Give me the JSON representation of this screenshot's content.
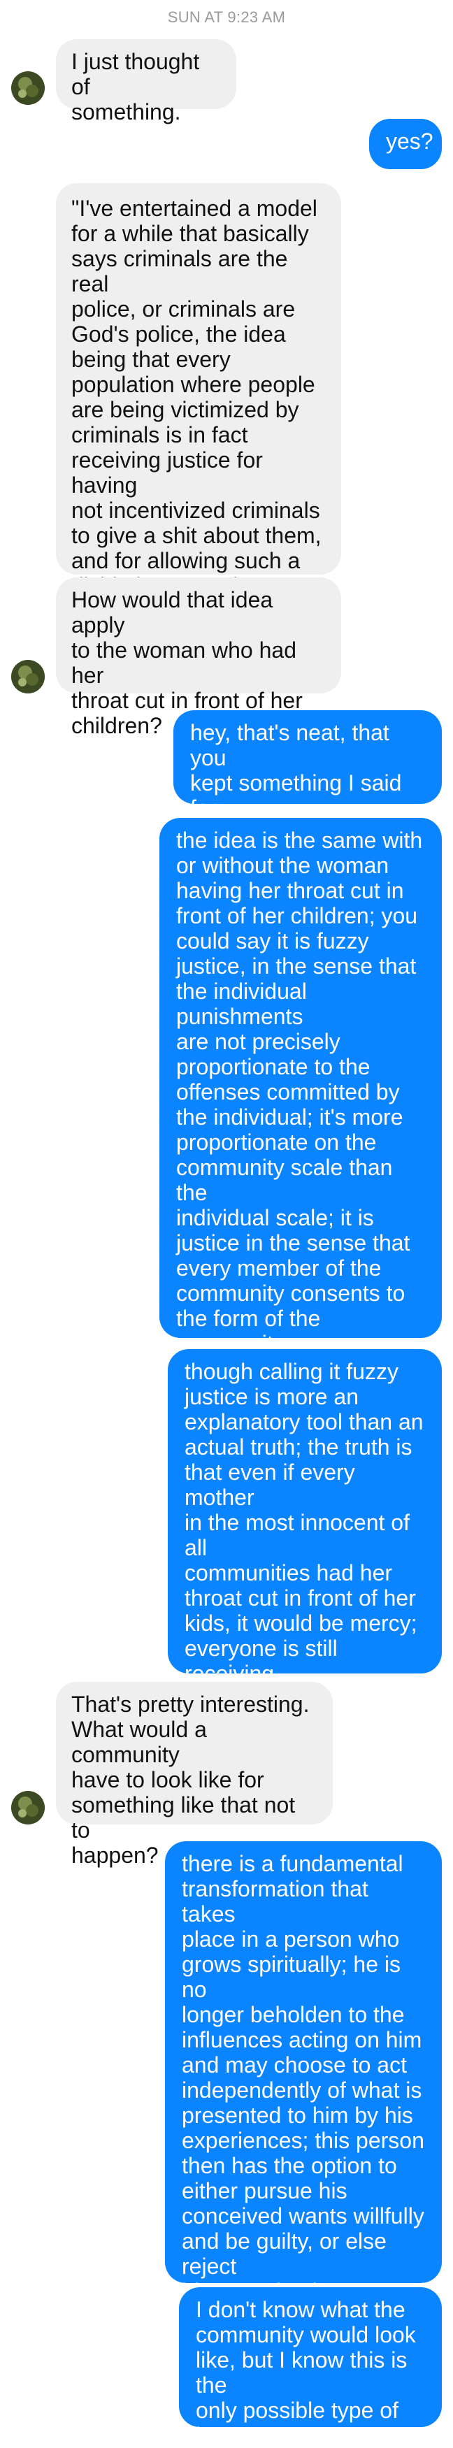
{
  "conversation": {
    "timestamp": "SUN AT 9:23 AM",
    "messages": [
      {
        "sender": "them",
        "text": "I just thought of\nsomething."
      },
      {
        "sender": "me",
        "text": "yes?"
      },
      {
        "sender": "them",
        "text": "\"I've entertained a model\nfor a while that basically\nsays criminals are the real\npolice, or criminals are\nGod's police, the idea\nbeing that every\npopulation where people\nare being victimized by\ncriminals is in fact\nreceiving justice for having\nnot incentivized criminals\nto give a shit about them,\nand for allowing such a\ndivide between those who\nhave and those who want\""
      },
      {
        "sender": "them",
        "text": "How would that idea apply\nto the woman who had her\nthroat cut in front of her\nchildren?"
      },
      {
        "sender": "me",
        "text": "hey, that's neat, that you\nkept something I said for\nfuture consideration"
      },
      {
        "sender": "me",
        "text": "the idea is the same with\nor without the woman\nhaving her throat cut in\nfront of her children; you\ncould say it is fuzzy\njustice, in the sense that\nthe individual punishments\nare not precisely\nproportionate to the\noffenses committed by\nthe individual; it's more\nproportionate on the\ncommunity scale than the\nindividual scale; it is\njustice in the sense that\nevery member of the\ncommunity consents to\nthe form of the community\nand plays a role in\ndictating its form"
      },
      {
        "sender": "me",
        "text": "though calling it fuzzy\njustice is more an\nexplanatory tool than an\nactual truth; the truth is\nthat even if every mother\nin the most innocent of all\ncommunities had her\nthroat cut in front of her\nkids, it would be mercy;\neveryone is still receiving\nmore grace than he has\nearned, for free"
      },
      {
        "sender": "them",
        "text": "That's pretty interesting.\nWhat would a community\nhave to look like for\nsomething like that not to\nhappen?"
      },
      {
        "sender": "me",
        "text": "there is a fundamental\ntransformation that takes\nplace in a person who\ngrows spiritually; he is no\nlonger beholden to the\ninfluences acting on him\nand may choose to act\nindependently of what is\npresented to him by his\nexperiences; this person\nthen has the option to\neither pursue his\nconceived wants willfully\nand be guilty, or else reject\nhis conceived wants and\nseek the good, and be\ninnocent"
      },
      {
        "sender": "me",
        "text": "I don't know what the\ncommunity would look\nlike, but I know this is the\nonly possible type of\ninnocent person"
      }
    ]
  },
  "colors": {
    "incoming_bubble": "#efefef",
    "outgoing_bubble": "#0a84ff",
    "timestamp_text": "#9a9a9a"
  },
  "icons": {
    "avatar": "contact-avatar-photo"
  }
}
